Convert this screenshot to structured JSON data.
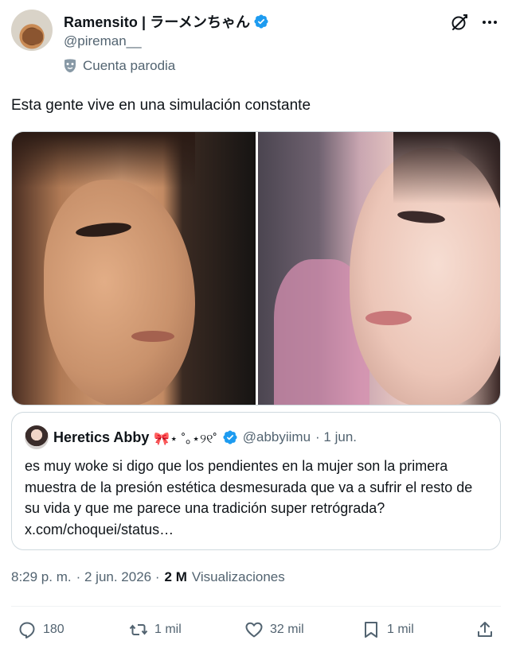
{
  "author": {
    "display_name": "Ramensito | ラーメンちゃん",
    "handle": "@pireman__",
    "label": "Cuenta parodia",
    "avatar_icon": "avatar-dog",
    "verified_color": "#1d9bf0"
  },
  "tweet": {
    "text": "Esta gente vive en una simulación constante"
  },
  "quoted": {
    "display_name": "Heretics Abby",
    "name_decoration": "🎀⋆ ˚｡⋆୨୧˚",
    "handle": "@abbyiimu",
    "date": "· 1 jun.",
    "text": "es muy woke si digo que los pendientes en la mujer son la primera muestra de la presión estética desmesurada que va a sufrir el resto de su vida y que me parece una tradición super retrógrada? x.com/choquei/status…"
  },
  "meta": {
    "time": "8:29 p. m.",
    "date": "· 2 jun. 2026 ·",
    "views_count": "2 M",
    "views_label": "Visualizaciones"
  },
  "actions": {
    "replies": "180",
    "reposts": "1 mil",
    "likes": "32 mil",
    "bookmarks": "1 mil"
  }
}
